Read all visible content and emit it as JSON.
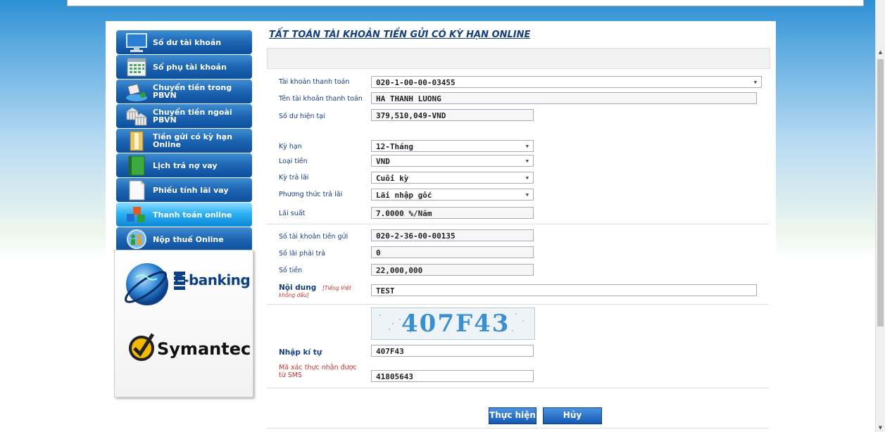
{
  "menu": {
    "items": [
      {
        "label": "Số dư tài khoản",
        "icon": "monitor-icon"
      },
      {
        "label": "Sổ phụ tài khoản",
        "icon": "calendar-icon"
      },
      {
        "label": "Chuyển tiền trong PBVN",
        "icon": "transfer-icon"
      },
      {
        "label": "Chuyển tiền ngoài PBVN",
        "icon": "bank-icon"
      },
      {
        "label": "Tiền gửi có kỳ hạn Online",
        "icon": "folder-icon"
      },
      {
        "label": "Lịch trả nợ vay",
        "icon": "notebook-icon"
      },
      {
        "label": "Phiếu tính lãi vay",
        "icon": "document-icon"
      },
      {
        "label": "Thanh toán online",
        "icon": "blocks-icon"
      },
      {
        "label": "Nộp thuế Online",
        "icon": "people-icon"
      }
    ],
    "active_index": 7
  },
  "brand": {
    "ebanking": "E-banking",
    "symantec": "Symantec"
  },
  "form": {
    "title": "TẤT TOÁN TÀI KHOẢN TIỀN GỬI CÓ KỲ HẠN ONLINE",
    "payment_account_label": "Tài khoản thanh toán",
    "payment_account_value": "020-1-00-00-03455",
    "account_name_label": "Tên tài khoản thanh toán",
    "account_name_value": "HA THANH LUONG",
    "balance_label": "Số dư hiện tại",
    "balance_value": "379,510,049-VND",
    "term_label": "Kỳ hạn",
    "term_value": "12-Tháng",
    "currency_label": "Loại tiền",
    "currency_value": "VND",
    "interest_period_label": "Kỳ trả lãi",
    "interest_period_value": "Cuối kỳ",
    "interest_method_label": "Phương thức trả lãi",
    "interest_method_value": "Lãi nhập gốc",
    "rate_label": "Lãi suất",
    "rate_value": "7.0000 %/Năm",
    "deposit_account_label": "Số tài khoản tiền gửi",
    "deposit_account_value": "020-2-36-00-00135",
    "interest_due_label": "Số lãi phải trả",
    "interest_due_value": "0",
    "amount_label": "Số tiền",
    "amount_value": "22,000,000",
    "content_label": "Nội dung",
    "content_hint": "[Tiếng Việt không dấu]",
    "content_value": "TEST",
    "captcha_text": "407F43",
    "captcha_input_label": "Nhập kí tự",
    "captcha_input_value": "407F43",
    "sms_label": "Mã xác thực nhận được từ SMS",
    "sms_value": "41805643",
    "submit_label": "Thực hiện",
    "cancel_label": "Hủy"
  }
}
